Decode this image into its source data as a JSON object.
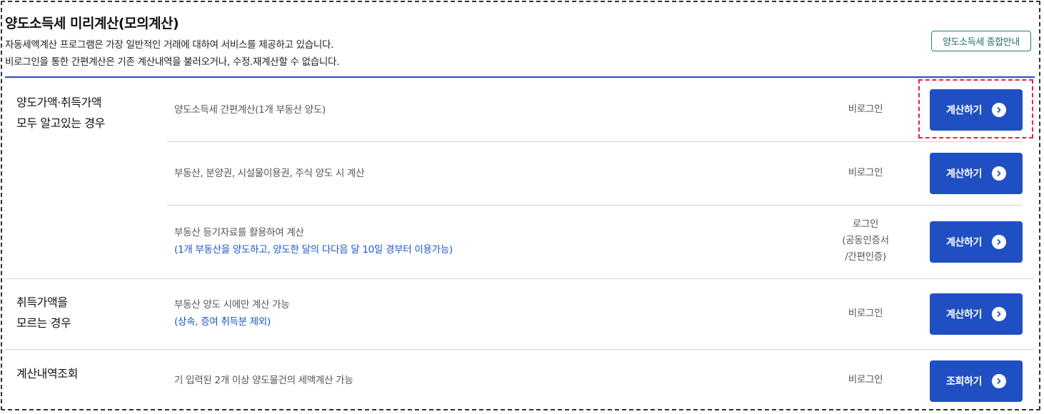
{
  "header": {
    "title": "양도소득세 미리계산(모의계산)",
    "desc_line1": "자동세액계산 프로그램은 가장 일반적인 거래에 대하여 서비스를 제공하고 있습니다.",
    "desc_line2": "비로그인을 통한 간편계산은 기존 계산내역을 불러오거나, 수정.재계산할 수 없습니다.",
    "guide_button": "양도소득세 종합안내"
  },
  "categories": {
    "known": {
      "line1": "양도가액·취득가액",
      "line2": "모두 알고있는 경우"
    },
    "unknown": {
      "line1": "취득가액을",
      "line2": "모르는 경우"
    },
    "history": {
      "line1": "계산내역조회"
    }
  },
  "rows": [
    {
      "desc": "양도소득세 간편계산(1개 부동산 양도)",
      "login": "비로그인",
      "button": "계산하기"
    },
    {
      "desc": "부동산, 분양권, 시설물이용권, 주식 양도 시 계산",
      "login": "비로그인",
      "button": "계산하기"
    },
    {
      "desc": "부동산 등기자료를 활용하여 계산",
      "note": "(1개 부동산을 양도하고, 양도한 달의 다다음 달 10일 경부터 이용가능)",
      "login_line1": "로그인",
      "login_line2": "(공동인증서",
      "login_line3": "/간편인증)",
      "button": "계산하기"
    },
    {
      "desc": "부동산 양도 시에만 계산 가능",
      "note": "(상속, 증여 취득분 제외)",
      "login": "비로그인",
      "button": "계산하기"
    },
    {
      "desc": "기 입력된 2개 이상 양도물건의 세액계산 가능",
      "login": "비로그인",
      "button": "조회하기"
    }
  ],
  "colors": {
    "primary_button": "#1f4fc2",
    "accent_line": "#2f44c9",
    "note_text": "#1e56c8",
    "highlight": "#e8243c"
  },
  "icons": {
    "button_arrow": "chevron-right-circle-icon"
  }
}
